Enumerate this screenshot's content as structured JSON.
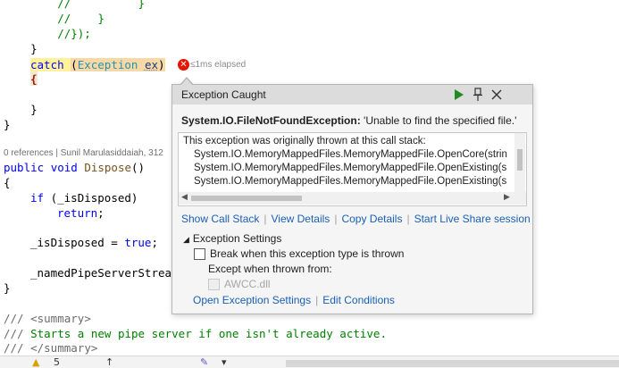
{
  "code_lines": {
    "l1": "        //          }",
    "l2": "        //    }",
    "l3": "        //});",
    "l4": "    }",
    "l5_catch": "catch",
    "l5_open": "(",
    "l5_type": "Exception",
    "l5_var": "ex",
    "l5_close": ")",
    "l6": "{",
    "l7": "    }",
    "l8": "}",
    "codelens": "0 references | Sunil Marulasiddaiah, 312",
    "l9_kw1": "public",
    "l9_kw2": "void",
    "l9_fn": "Dispose",
    "l9_rest": "()",
    "l10": "{",
    "l11_if": "if",
    "l11_rest": " (_isDisposed)",
    "l12_kw": "return",
    "l12_rest": ";",
    "l13_left": "_isDisposed = ",
    "l13_true": "true",
    "l13_semi": ";",
    "l14": "_namedPipeServerStrea",
    "l15": "}",
    "l16_prefix": "/// ",
    "l16_tag": "<summary>",
    "l17_prefix": "/// ",
    "l17_text": "Starts a new pipe server if one isn't already active.",
    "l18_prefix": "/// ",
    "l18_tag": "</summary>"
  },
  "elapsed": "≤1ms elapsed",
  "error_badge": "✕",
  "popup": {
    "title": "Exception Caught",
    "exception_type": "System.IO.FileNotFoundException:",
    "exception_message": " 'Unable to find the specified file.'",
    "stack_intro": "This exception was originally thrown at this call stack:",
    "stack": [
      "System.IO.MemoryMappedFiles.MemoryMappedFile.OpenCore(strin",
      "System.IO.MemoryMappedFiles.MemoryMappedFile.OpenExisting(s",
      "System.IO.MemoryMappedFiles.MemoryMappedFile.OpenExisting(s"
    ],
    "links": {
      "show_call_stack": "Show Call Stack",
      "view_details": "View Details",
      "copy_details": "Copy Details",
      "live_share": "Start Live Share session"
    },
    "settings_header": "Exception Settings",
    "break_when_thrown": "Break when this exception type is thrown",
    "except_when": "Except when thrown from:",
    "module": "AWCC.dll",
    "open_settings": "Open Exception Settings",
    "edit_conditions": "Edit Conditions",
    "icons": {
      "play": "play-icon",
      "pin": "pin-icon",
      "close": "close-icon"
    }
  },
  "statusbar": {
    "warning_count": "5"
  },
  "colors": {
    "comment": "#008000",
    "keyword": "#0000ff",
    "type": "#2b91af",
    "link": "#1a5fb4",
    "error": "#e51400",
    "catch_highlight": "#fff29a",
    "play_green": "#1e8c1e"
  }
}
